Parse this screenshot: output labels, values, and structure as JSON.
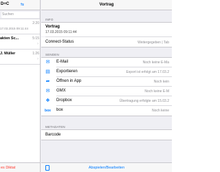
{
  "left_pane": {
    "title": "D+C",
    "nav_icon": "⇆",
    "nav_button": "",
    "search_placeholder": "Suchen",
    "items": [
      {
        "title": "",
        "subtitle": "17.03.2015 09:11:44",
        "duration": "2:20"
      },
      {
        "title": "akten Sc...",
        "subtitle": "",
        "duration": "5:15"
      },
      {
        "title": "J. Müller",
        "subtitle": "",
        "duration": "1:26"
      }
    ],
    "toolbar_label": "es Diktat"
  },
  "detail": {
    "nav_title": "Vortrag",
    "info_header": "INFO",
    "info_title": "Vortrag",
    "info_date": "17.03.2015 09:11:44",
    "connect_label": "Connect-Status",
    "connect_value": "Weitergegeben | Tab",
    "send_header": "SENDEN",
    "send_items": [
      {
        "label": "E-Mail",
        "status": "Noch keine E-Ma",
        "icon": "mail-icon"
      },
      {
        "label": "Exportieren",
        "status": "Export ist erfolgt am 17.03.2",
        "icon": "export-icon"
      },
      {
        "label": "Öffnen in App",
        "status": "Noch kein",
        "icon": "open-in-icon"
      },
      {
        "label": "GMX",
        "status": "Noch keine E-M",
        "icon": "gmx-mail-icon"
      },
      {
        "label": "Dropbox",
        "status": "Übertragung erfolgte am 15.03.2",
        "icon": "dropbox-icon"
      },
      {
        "label": "box",
        "status": "Noch keine",
        "icon": "box-icon"
      }
    ],
    "meta_header": "METADATEN",
    "barcode_label": "Barcode",
    "toolbar_label": "Abspielen/Bearbeiten"
  },
  "colors": {
    "accent": "#007aff",
    "destructive": "#ff3b30",
    "background": "#efeff4"
  }
}
